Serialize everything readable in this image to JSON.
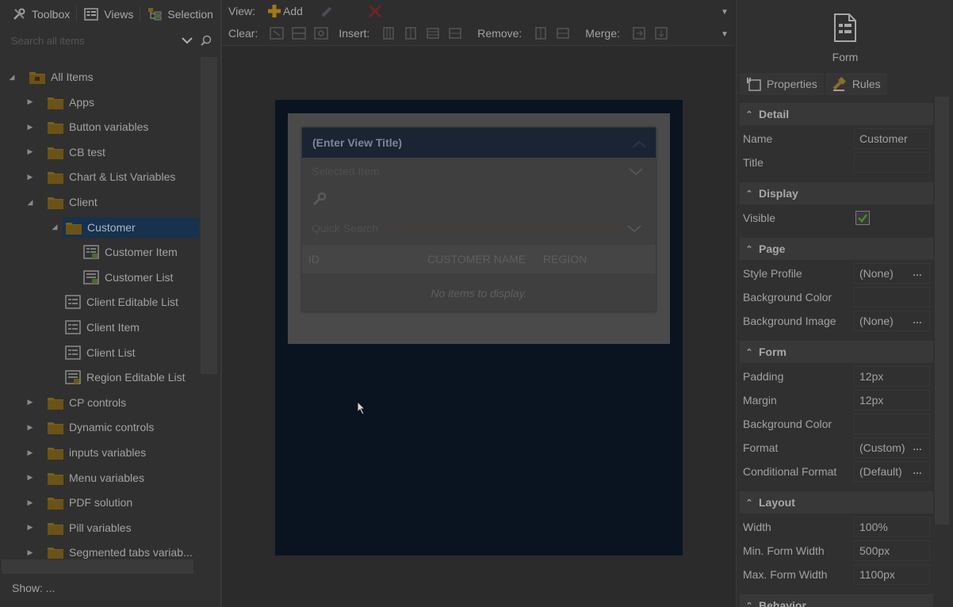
{
  "left": {
    "tabs": [
      {
        "label": "Toolbox",
        "icon": "toolbox-icon"
      },
      {
        "label": "Views",
        "icon": "views-icon"
      },
      {
        "label": "Selection",
        "icon": "selection-icon"
      }
    ],
    "search": {
      "placeholder": "Search all items",
      "value": ""
    },
    "tree": [
      {
        "label": "All Items",
        "icon": "all-items-icon",
        "level": 0,
        "arrow": "expanded"
      },
      {
        "label": "Apps",
        "icon": "folder-icon",
        "level": 1,
        "arrow": "collapsed"
      },
      {
        "label": "Button variables",
        "icon": "folder-icon",
        "level": 1,
        "arrow": "collapsed"
      },
      {
        "label": "CB test",
        "icon": "folder-icon",
        "level": 1,
        "arrow": "collapsed"
      },
      {
        "label": "Chart & List Variables",
        "icon": "folder-icon",
        "level": 1,
        "arrow": "collapsed"
      },
      {
        "label": "Client",
        "icon": "folder-icon",
        "level": 1,
        "arrow": "expanded"
      },
      {
        "label": "Customer",
        "icon": "folder-icon",
        "level": 2,
        "arrow": "expanded",
        "selected": true
      },
      {
        "label": "Customer Item",
        "icon": "item-view-icon",
        "level": 3,
        "arrow": "none"
      },
      {
        "label": "Customer List",
        "icon": "list-view-icon",
        "level": 3,
        "arrow": "none"
      },
      {
        "label": "Client Editable List",
        "icon": "view-icon",
        "level": 2,
        "arrow": "none"
      },
      {
        "label": "Client Item",
        "icon": "view-icon",
        "level": 2,
        "arrow": "none"
      },
      {
        "label": "Client List",
        "icon": "view-icon",
        "level": 2,
        "arrow": "none"
      },
      {
        "label": "Region Editable List",
        "icon": "editable-list-icon",
        "level": 2,
        "arrow": "none"
      },
      {
        "label": "CP controls",
        "icon": "folder-icon",
        "level": 1,
        "arrow": "collapsed"
      },
      {
        "label": "Dynamic controls",
        "icon": "folder-icon",
        "level": 1,
        "arrow": "collapsed"
      },
      {
        "label": "inputs variables",
        "icon": "folder-icon",
        "level": 1,
        "arrow": "collapsed"
      },
      {
        "label": "Menu variables",
        "icon": "folder-icon",
        "level": 1,
        "arrow": "collapsed"
      },
      {
        "label": "PDF solution",
        "icon": "folder-icon",
        "level": 1,
        "arrow": "collapsed"
      },
      {
        "label": "Pill variables",
        "icon": "folder-icon",
        "level": 1,
        "arrow": "collapsed"
      },
      {
        "label": "Segmented tabs variab...",
        "icon": "folder-icon",
        "level": 1,
        "arrow": "collapsed"
      }
    ],
    "show_label": "Show: ..."
  },
  "toolbar": {
    "view_label": "View:",
    "add_label": "Add",
    "clear_label": "Clear:",
    "insert_label": "Insert:",
    "remove_label": "Remove:",
    "merge_label": "Merge:"
  },
  "canvas": {
    "view_title": "(Enter View Title)",
    "selected_field": "Selected Item",
    "quick_search": "Quick Search",
    "columns": [
      "ID",
      "CUSTOMER NAME",
      "REGION"
    ],
    "empty_text": "No items to display."
  },
  "right": {
    "form_label": "Form",
    "tabs": [
      {
        "label": "Properties",
        "icon": "properties-icon"
      },
      {
        "label": "Rules",
        "icon": "rules-icon"
      }
    ],
    "sections": [
      {
        "title": "Detail",
        "rows": [
          {
            "name": "Name",
            "value": "Customer"
          },
          {
            "name": "Title",
            "value": ""
          }
        ]
      },
      {
        "title": "Display",
        "rows": [
          {
            "name": "Visible",
            "value": "",
            "checkbox": true,
            "checked": true
          }
        ]
      },
      {
        "title": "Page",
        "rows": [
          {
            "name": "Style Profile",
            "value": "(None)",
            "dots": true
          },
          {
            "name": "Background Color",
            "value": ""
          },
          {
            "name": "Background Image",
            "value": "(None)",
            "dots": true
          }
        ]
      },
      {
        "title": "Form",
        "rows": [
          {
            "name": "Padding",
            "value": "12px"
          },
          {
            "name": "Margin",
            "value": "12px"
          },
          {
            "name": "Background Color",
            "value": ""
          },
          {
            "name": "Format",
            "value": "(Custom)",
            "dots": true
          },
          {
            "name": "Conditional Format",
            "value": "(Default)",
            "dots": true
          }
        ]
      },
      {
        "title": "Layout",
        "rows": [
          {
            "name": "Width",
            "value": "100%"
          },
          {
            "name": "Min. Form Width",
            "value": "500px"
          },
          {
            "name": "Max. Form Width",
            "value": "1100px"
          }
        ]
      },
      {
        "title": "Behavior",
        "rows": []
      }
    ]
  },
  "colors": {
    "selection": "#16324d",
    "folder": "#7a5e1a",
    "form_surface": "#0a1420",
    "view_header": "#1b2433"
  }
}
